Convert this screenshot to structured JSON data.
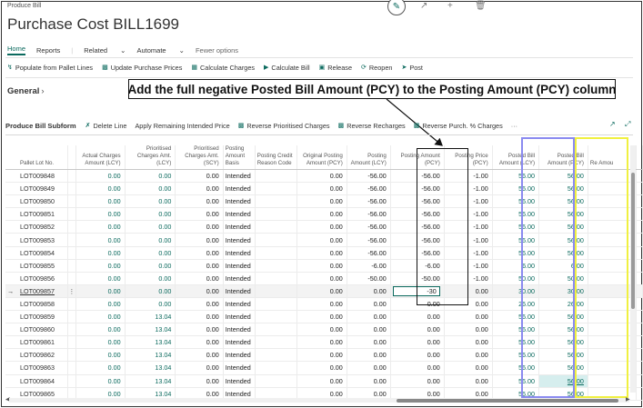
{
  "breadcrumb": "Produce Bill",
  "page_title": "Purchase Cost BILL1699",
  "actionbar": {
    "home": "Home",
    "reports": "Reports",
    "related": "Related",
    "automate": "Automate",
    "fewer": "Fewer options"
  },
  "toolbar": {
    "populate": "Populate from Pallet Lines",
    "update_prices": "Update Purchase Prices",
    "calc_charges": "Calculate Charges",
    "calc_bill": "Calculate Bill",
    "release": "Release",
    "reopen": "Reopen",
    "post": "Post"
  },
  "general_label": "General",
  "callout": "Add the full negative Posted Bill Amount (PCY) to the Posting Amount (PCY) column",
  "subform": {
    "title": "Produce Bill Subform",
    "delete_line": "Delete Line",
    "apply_remaining": "Apply Remaining Intended Price",
    "reverse_prioritised": "Reverse Prioritised Charges",
    "reverse_recharges": "Reverse Recharges",
    "reverse_purch": "Reverse Purch. % Charges",
    "more": "···"
  },
  "columns": {
    "lot": "Pallet Lot No.",
    "actual": "Actual Charges Amount (LCY)",
    "prior_amt": "Prioritised Charges Amt. (LCY)",
    "prior_scy": "Prioritised Charges Amt. (SCY)",
    "basis": "Posting Amount Basis",
    "credit": "Posting Credit Reason Code",
    "orig": "Original Posting Amount (PCY)",
    "post_lcy": "Posting Amount (LCY)",
    "post_pcy": "Posting Amount (PCY)",
    "price": "Posting Price (PCY)",
    "bill_lcy": "Posted Bill Amount (LCY)",
    "bill_pcy": "Posted Bill Amount (PCY)",
    "extra": "Re Amou"
  },
  "rows": [
    {
      "lot": "LOT009848",
      "actual": "0.00",
      "prior": "0.00",
      "scy": "0.00",
      "basis": "Intended",
      "orig": "0.00",
      "post_lcy": "-56.00",
      "post_pcy": "-56.00",
      "price": "-1.00",
      "bill_lcy": "56.00",
      "bill_pcy": "56.00"
    },
    {
      "lot": "LOT009849",
      "actual": "0.00",
      "prior": "0.00",
      "scy": "0.00",
      "basis": "Intended",
      "orig": "0.00",
      "post_lcy": "-56.00",
      "post_pcy": "-56.00",
      "price": "-1.00",
      "bill_lcy": "56.00",
      "bill_pcy": "56.00"
    },
    {
      "lot": "LOT009850",
      "actual": "0.00",
      "prior": "0.00",
      "scy": "0.00",
      "basis": "Intended",
      "orig": "0.00",
      "post_lcy": "-56.00",
      "post_pcy": "-56.00",
      "price": "-1.00",
      "bill_lcy": "56.00",
      "bill_pcy": "56.00"
    },
    {
      "lot": "LOT009851",
      "actual": "0.00",
      "prior": "0.00",
      "scy": "0.00",
      "basis": "Intended",
      "orig": "0.00",
      "post_lcy": "-56.00",
      "post_pcy": "-56.00",
      "price": "-1.00",
      "bill_lcy": "56.00",
      "bill_pcy": "56.00"
    },
    {
      "lot": "LOT009852",
      "actual": "0.00",
      "prior": "0.00",
      "scy": "0.00",
      "basis": "Intended",
      "orig": "0.00",
      "post_lcy": "-56.00",
      "post_pcy": "-56.00",
      "price": "-1.00",
      "bill_lcy": "56.00",
      "bill_pcy": "56.00"
    },
    {
      "lot": "LOT009853",
      "actual": "0.00",
      "prior": "0.00",
      "scy": "0.00",
      "basis": "Intended",
      "orig": "0.00",
      "post_lcy": "-56.00",
      "post_pcy": "-56.00",
      "price": "-1.00",
      "bill_lcy": "56.00",
      "bill_pcy": "56.00"
    },
    {
      "lot": "LOT009854",
      "actual": "0.00",
      "prior": "0.00",
      "scy": "0.00",
      "basis": "Intended",
      "orig": "0.00",
      "post_lcy": "-56.00",
      "post_pcy": "-56.00",
      "price": "-1.00",
      "bill_lcy": "56.00",
      "bill_pcy": "56.00"
    },
    {
      "lot": "LOT009855",
      "actual": "0.00",
      "prior": "0.00",
      "scy": "0.00",
      "basis": "Intended",
      "orig": "0.00",
      "post_lcy": "-6.00",
      "post_pcy": "-6.00",
      "price": "-1.00",
      "bill_lcy": "6.00",
      "bill_pcy": "6.00"
    },
    {
      "lot": "LOT009856",
      "actual": "0.00",
      "prior": "0.00",
      "scy": "0.00",
      "basis": "Intended",
      "orig": "0.00",
      "post_lcy": "-50.00",
      "post_pcy": "-50.00",
      "price": "-1.00",
      "bill_lcy": "50.00",
      "bill_pcy": "50.00"
    },
    {
      "lot": "LOT009857",
      "actual": "0.00",
      "prior": "0.00",
      "scy": "0.00",
      "basis": "Intended",
      "orig": "0.00",
      "post_lcy": "0.00",
      "post_pcy": "-30",
      "price": "0.00",
      "bill_lcy": "30.00",
      "bill_pcy": "30.00"
    },
    {
      "lot": "LOT009858",
      "actual": "0.00",
      "prior": "0.00",
      "scy": "0.00",
      "basis": "Intended",
      "orig": "0.00",
      "post_lcy": "0.00",
      "post_pcy": "0.00",
      "price": "0.00",
      "bill_lcy": "26.00",
      "bill_pcy": "26.00"
    },
    {
      "lot": "LOT009859",
      "actual": "0.00",
      "prior": "13.04",
      "scy": "0.00",
      "basis": "Intended",
      "orig": "0.00",
      "post_lcy": "0.00",
      "post_pcy": "0.00",
      "price": "0.00",
      "bill_lcy": "56.00",
      "bill_pcy": "56.00"
    },
    {
      "lot": "LOT009860",
      "actual": "0.00",
      "prior": "13.04",
      "scy": "0.00",
      "basis": "Intended",
      "orig": "0.00",
      "post_lcy": "0.00",
      "post_pcy": "0.00",
      "price": "0.00",
      "bill_lcy": "56.00",
      "bill_pcy": "56.00"
    },
    {
      "lot": "LOT009861",
      "actual": "0.00",
      "prior": "13.04",
      "scy": "0.00",
      "basis": "Intended",
      "orig": "0.00",
      "post_lcy": "0.00",
      "post_pcy": "0.00",
      "price": "0.00",
      "bill_lcy": "56.00",
      "bill_pcy": "56.00"
    },
    {
      "lot": "LOT009862",
      "actual": "0.00",
      "prior": "13.04",
      "scy": "0.00",
      "basis": "Intended",
      "orig": "0.00",
      "post_lcy": "0.00",
      "post_pcy": "0.00",
      "price": "0.00",
      "bill_lcy": "56.00",
      "bill_pcy": "56.00"
    },
    {
      "lot": "LOT009863",
      "actual": "0.00",
      "prior": "13.04",
      "scy": "0.00",
      "basis": "Intended",
      "orig": "0.00",
      "post_lcy": "0.00",
      "post_pcy": "0.00",
      "price": "0.00",
      "bill_lcy": "56.00",
      "bill_pcy": "56.00"
    },
    {
      "lot": "LOT009864",
      "actual": "0.00",
      "prior": "13.04",
      "scy": "0.00",
      "basis": "Intended",
      "orig": "0.00",
      "post_lcy": "0.00",
      "post_pcy": "0.00",
      "price": "0.00",
      "bill_lcy": "56.00",
      "bill_pcy": "56.00"
    },
    {
      "lot": "LOT009865",
      "actual": "0.00",
      "prior": "13.04",
      "scy": "0.00",
      "basis": "Intended",
      "orig": "0.00",
      "post_lcy": "0.00",
      "post_pcy": "0.00",
      "price": "0.00",
      "bill_lcy": "56.00",
      "bill_pcy": "56.00"
    }
  ],
  "selected_row_index": 9,
  "highlighted_cell_row": 16,
  "colors": {
    "accent": "#0b6a5e",
    "blue_box": "#8a8af0",
    "yellow_box": "#f0f040"
  }
}
